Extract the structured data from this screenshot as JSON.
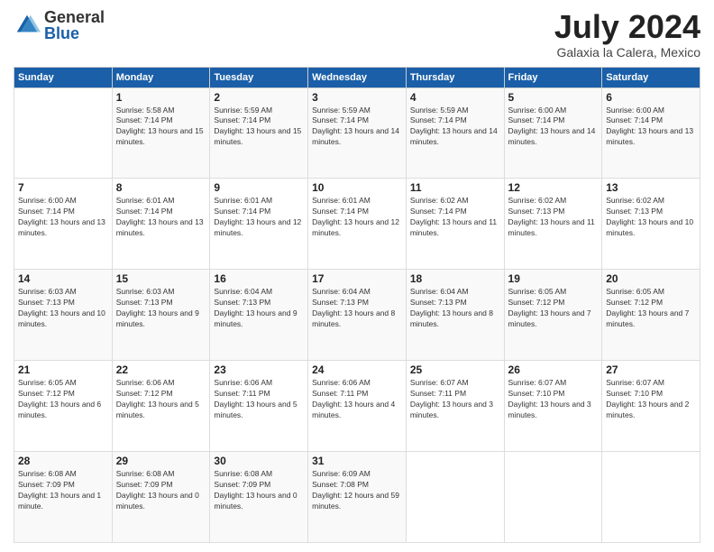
{
  "logo": {
    "general": "General",
    "blue": "Blue"
  },
  "title": "July 2024",
  "location": "Galaxia la Calera, Mexico",
  "days_of_week": [
    "Sunday",
    "Monday",
    "Tuesday",
    "Wednesday",
    "Thursday",
    "Friday",
    "Saturday"
  ],
  "weeks": [
    [
      {
        "day": "",
        "sunrise": "",
        "sunset": "",
        "daylight": ""
      },
      {
        "day": "1",
        "sunrise": "Sunrise: 5:58 AM",
        "sunset": "Sunset: 7:14 PM",
        "daylight": "Daylight: 13 hours and 15 minutes."
      },
      {
        "day": "2",
        "sunrise": "Sunrise: 5:59 AM",
        "sunset": "Sunset: 7:14 PM",
        "daylight": "Daylight: 13 hours and 15 minutes."
      },
      {
        "day": "3",
        "sunrise": "Sunrise: 5:59 AM",
        "sunset": "Sunset: 7:14 PM",
        "daylight": "Daylight: 13 hours and 14 minutes."
      },
      {
        "day": "4",
        "sunrise": "Sunrise: 5:59 AM",
        "sunset": "Sunset: 7:14 PM",
        "daylight": "Daylight: 13 hours and 14 minutes."
      },
      {
        "day": "5",
        "sunrise": "Sunrise: 6:00 AM",
        "sunset": "Sunset: 7:14 PM",
        "daylight": "Daylight: 13 hours and 14 minutes."
      },
      {
        "day": "6",
        "sunrise": "Sunrise: 6:00 AM",
        "sunset": "Sunset: 7:14 PM",
        "daylight": "Daylight: 13 hours and 13 minutes."
      }
    ],
    [
      {
        "day": "7",
        "sunrise": "Sunrise: 6:00 AM",
        "sunset": "Sunset: 7:14 PM",
        "daylight": "Daylight: 13 hours and 13 minutes."
      },
      {
        "day": "8",
        "sunrise": "Sunrise: 6:01 AM",
        "sunset": "Sunset: 7:14 PM",
        "daylight": "Daylight: 13 hours and 13 minutes."
      },
      {
        "day": "9",
        "sunrise": "Sunrise: 6:01 AM",
        "sunset": "Sunset: 7:14 PM",
        "daylight": "Daylight: 13 hours and 12 minutes."
      },
      {
        "day": "10",
        "sunrise": "Sunrise: 6:01 AM",
        "sunset": "Sunset: 7:14 PM",
        "daylight": "Daylight: 13 hours and 12 minutes."
      },
      {
        "day": "11",
        "sunrise": "Sunrise: 6:02 AM",
        "sunset": "Sunset: 7:14 PM",
        "daylight": "Daylight: 13 hours and 11 minutes."
      },
      {
        "day": "12",
        "sunrise": "Sunrise: 6:02 AM",
        "sunset": "Sunset: 7:13 PM",
        "daylight": "Daylight: 13 hours and 11 minutes."
      },
      {
        "day": "13",
        "sunrise": "Sunrise: 6:02 AM",
        "sunset": "Sunset: 7:13 PM",
        "daylight": "Daylight: 13 hours and 10 minutes."
      }
    ],
    [
      {
        "day": "14",
        "sunrise": "Sunrise: 6:03 AM",
        "sunset": "Sunset: 7:13 PM",
        "daylight": "Daylight: 13 hours and 10 minutes."
      },
      {
        "day": "15",
        "sunrise": "Sunrise: 6:03 AM",
        "sunset": "Sunset: 7:13 PM",
        "daylight": "Daylight: 13 hours and 9 minutes."
      },
      {
        "day": "16",
        "sunrise": "Sunrise: 6:04 AM",
        "sunset": "Sunset: 7:13 PM",
        "daylight": "Daylight: 13 hours and 9 minutes."
      },
      {
        "day": "17",
        "sunrise": "Sunrise: 6:04 AM",
        "sunset": "Sunset: 7:13 PM",
        "daylight": "Daylight: 13 hours and 8 minutes."
      },
      {
        "day": "18",
        "sunrise": "Sunrise: 6:04 AM",
        "sunset": "Sunset: 7:13 PM",
        "daylight": "Daylight: 13 hours and 8 minutes."
      },
      {
        "day": "19",
        "sunrise": "Sunrise: 6:05 AM",
        "sunset": "Sunset: 7:12 PM",
        "daylight": "Daylight: 13 hours and 7 minutes."
      },
      {
        "day": "20",
        "sunrise": "Sunrise: 6:05 AM",
        "sunset": "Sunset: 7:12 PM",
        "daylight": "Daylight: 13 hours and 7 minutes."
      }
    ],
    [
      {
        "day": "21",
        "sunrise": "Sunrise: 6:05 AM",
        "sunset": "Sunset: 7:12 PM",
        "daylight": "Daylight: 13 hours and 6 minutes."
      },
      {
        "day": "22",
        "sunrise": "Sunrise: 6:06 AM",
        "sunset": "Sunset: 7:12 PM",
        "daylight": "Daylight: 13 hours and 5 minutes."
      },
      {
        "day": "23",
        "sunrise": "Sunrise: 6:06 AM",
        "sunset": "Sunset: 7:11 PM",
        "daylight": "Daylight: 13 hours and 5 minutes."
      },
      {
        "day": "24",
        "sunrise": "Sunrise: 6:06 AM",
        "sunset": "Sunset: 7:11 PM",
        "daylight": "Daylight: 13 hours and 4 minutes."
      },
      {
        "day": "25",
        "sunrise": "Sunrise: 6:07 AM",
        "sunset": "Sunset: 7:11 PM",
        "daylight": "Daylight: 13 hours and 3 minutes."
      },
      {
        "day": "26",
        "sunrise": "Sunrise: 6:07 AM",
        "sunset": "Sunset: 7:10 PM",
        "daylight": "Daylight: 13 hours and 3 minutes."
      },
      {
        "day": "27",
        "sunrise": "Sunrise: 6:07 AM",
        "sunset": "Sunset: 7:10 PM",
        "daylight": "Daylight: 13 hours and 2 minutes."
      }
    ],
    [
      {
        "day": "28",
        "sunrise": "Sunrise: 6:08 AM",
        "sunset": "Sunset: 7:09 PM",
        "daylight": "Daylight: 13 hours and 1 minute."
      },
      {
        "day": "29",
        "sunrise": "Sunrise: 6:08 AM",
        "sunset": "Sunset: 7:09 PM",
        "daylight": "Daylight: 13 hours and 0 minutes."
      },
      {
        "day": "30",
        "sunrise": "Sunrise: 6:08 AM",
        "sunset": "Sunset: 7:09 PM",
        "daylight": "Daylight: 13 hours and 0 minutes."
      },
      {
        "day": "31",
        "sunrise": "Sunrise: 6:09 AM",
        "sunset": "Sunset: 7:08 PM",
        "daylight": "Daylight: 12 hours and 59 minutes."
      },
      {
        "day": "",
        "sunrise": "",
        "sunset": "",
        "daylight": ""
      },
      {
        "day": "",
        "sunrise": "",
        "sunset": "",
        "daylight": ""
      },
      {
        "day": "",
        "sunrise": "",
        "sunset": "",
        "daylight": ""
      }
    ]
  ]
}
